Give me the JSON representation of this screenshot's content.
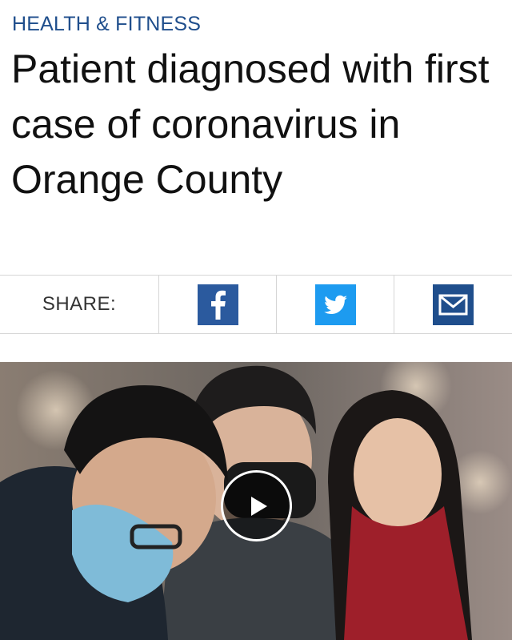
{
  "article": {
    "category": "HEALTH & FITNESS",
    "headline": "Patient diagnosed with first case of coronavirus in Orange County"
  },
  "share": {
    "label": "SHARE:",
    "buttons": [
      {
        "name": "facebook",
        "icon": "facebook-icon",
        "color": "#2b5a9e"
      },
      {
        "name": "twitter",
        "icon": "twitter-icon",
        "color": "#1d9bf0"
      },
      {
        "name": "email",
        "icon": "mail-icon",
        "color": "#1f4e8c"
      }
    ]
  },
  "media": {
    "type": "video",
    "description_icon": "play-icon"
  }
}
